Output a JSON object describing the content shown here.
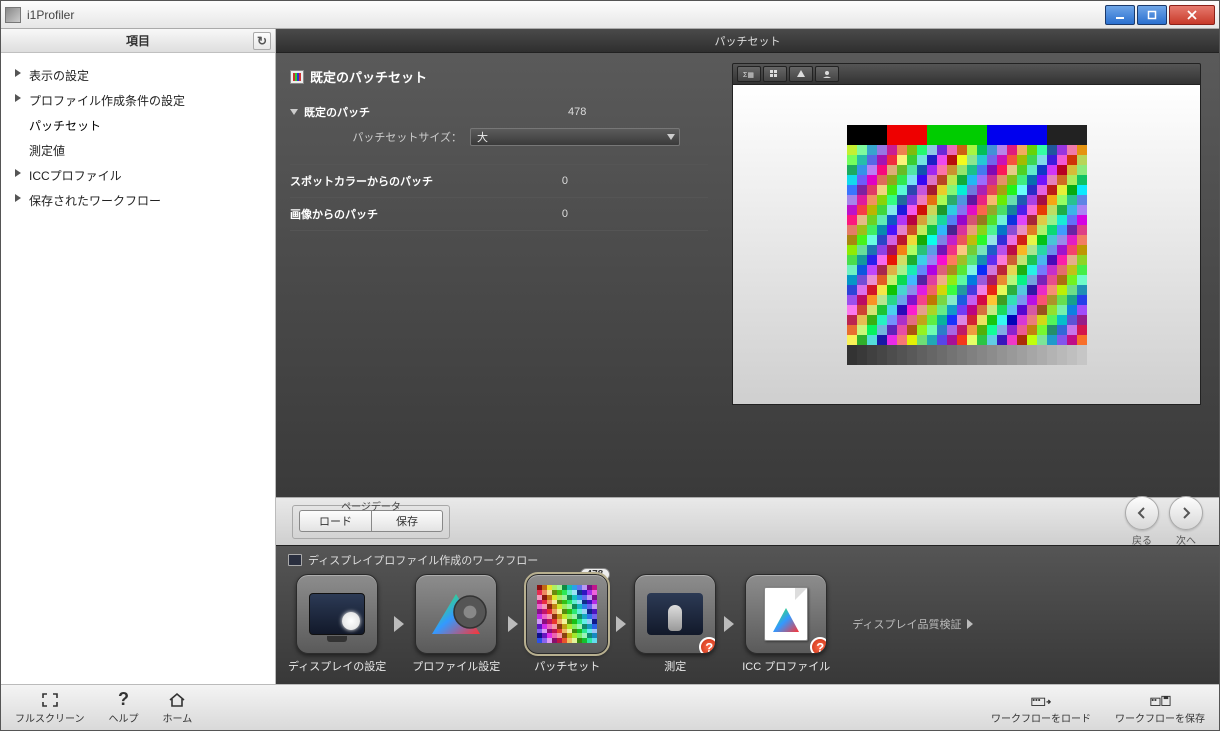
{
  "app_title": "i1Profiler",
  "sidebar": {
    "header": "項目",
    "items": [
      {
        "label": "表示の設定",
        "tri": true
      },
      {
        "label": "プロファイル作成条件の設定",
        "tri": true
      },
      {
        "label": "パッチセット",
        "tri": false,
        "selected": true
      },
      {
        "label": "測定値",
        "tri": false
      },
      {
        "label": "ICCプロファイル",
        "tri": true
      },
      {
        "label": "保存されたワークフロー",
        "tri": true
      }
    ]
  },
  "main_header": "パッチセット",
  "panel": {
    "title": "既定のパッチセット",
    "default_patch": {
      "label": "既定のパッチ",
      "count": "478"
    },
    "size_label": "パッチセットサイズ：",
    "size_value": "大",
    "spot": {
      "label": "スポットカラーからのパッチ",
      "count": "0"
    },
    "image": {
      "label": "画像からのパッチ",
      "count": "0"
    }
  },
  "pagedata": {
    "legend": "ページデータ",
    "load": "ロード",
    "save": "保存"
  },
  "nav": {
    "back": "戻る",
    "next": "次へ"
  },
  "workflow": {
    "title": "ディスプレイプロファイル作成のワークフロー",
    "items": [
      {
        "label": "ディスプレイの設定"
      },
      {
        "label": "プロファイル設定"
      },
      {
        "label": "パッチセット",
        "badge": "478",
        "active": true
      },
      {
        "label": "測定",
        "warn": true
      },
      {
        "label": "ICC プロファイル",
        "warn": true
      }
    ],
    "link": "ディスプレイ品質検証"
  },
  "footer": {
    "fullscreen": "フルスクリーン",
    "help": "ヘルプ",
    "home": "ホーム",
    "wf_load": "ワークフローをロード",
    "wf_save": "ワークフローを保存"
  }
}
